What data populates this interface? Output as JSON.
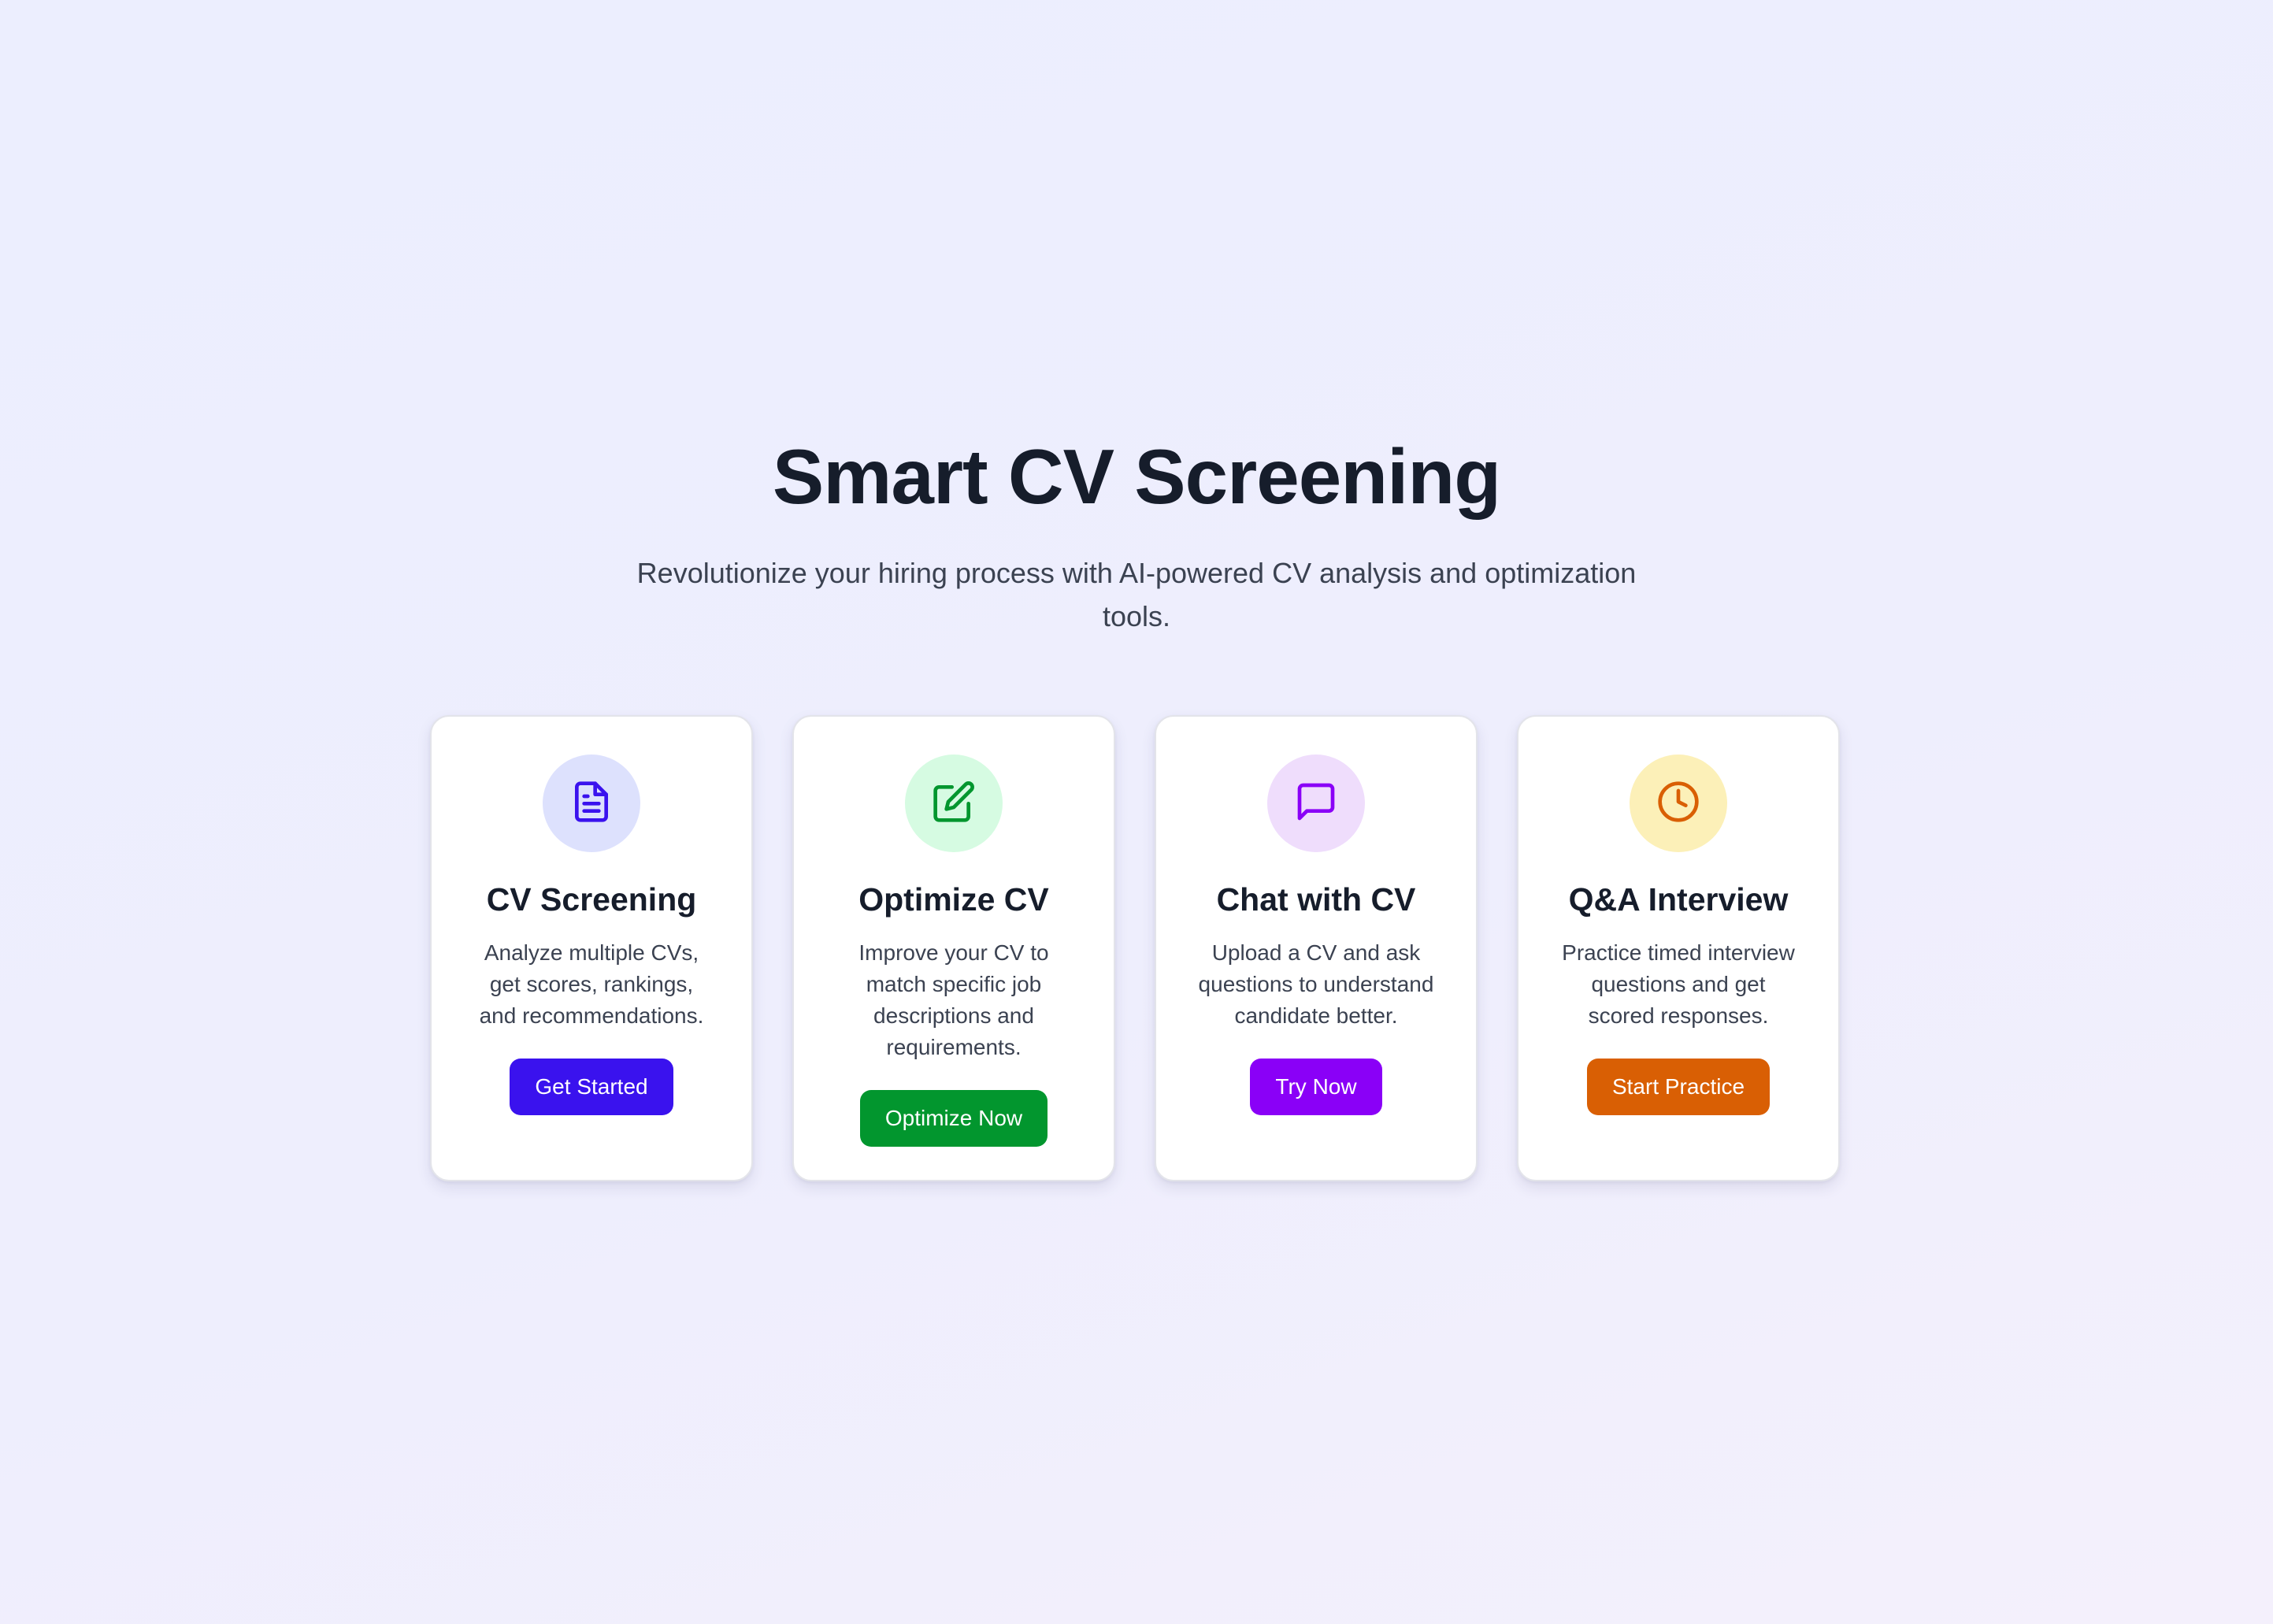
{
  "hero": {
    "title": "Smart CV Screening",
    "subtitle": "Revolutionize your hiring process with AI-powered CV analysis and optimization tools."
  },
  "cards": [
    {
      "icon": "document-icon",
      "title": "CV Screening",
      "description": "Analyze multiple CVs, get scores, rankings, and recommendations.",
      "button_label": "Get Started",
      "accent_color": "#3a12ee",
      "icon_bg_color": "#dde1fd"
    },
    {
      "icon": "edit-icon",
      "title": "Optimize CV",
      "description": "Improve your CV to match specific job descriptions and requirements.",
      "button_label": "Optimize Now",
      "accent_color": "#02962e",
      "icon_bg_color": "#d6fbe2"
    },
    {
      "icon": "chat-icon",
      "title": "Chat with CV",
      "description": "Upload a CV and ask questions to understand candidate better.",
      "button_label": "Try Now",
      "accent_color": "#8a00f7",
      "icon_bg_color": "#efddfc"
    },
    {
      "icon": "clock-icon",
      "title": "Q&A Interview",
      "description": "Practice timed interview questions and get scored responses.",
      "button_label": "Start Practice",
      "accent_color": "#d95f04",
      "icon_bg_color": "#fcf0b8"
    }
  ]
}
